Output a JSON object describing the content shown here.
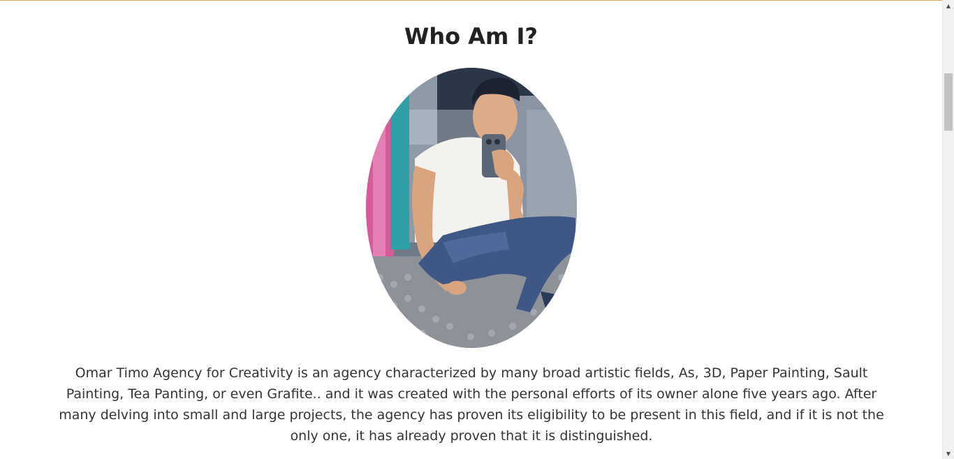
{
  "about": {
    "title": "Who Am I?",
    "photo_alt": "portrait-photo",
    "text": "Omar Timo Agency for Creativity is an agency characterized by many broad artistic fields, As, 3D, Paper Painting, Sault Painting, Tea Panting, or even Grafite.. and it was created with the personal efforts of its owner alone five years ago. After many delving into small and large projects, the agency has proven its eligibility to be present in this field, and if it is not the only one, it has already proven that it is distinguished."
  },
  "scrollbar": {
    "up_icon": "▲",
    "down_icon": "▼"
  },
  "colors": {
    "accent_border": "#e0a75a",
    "title": "#222222",
    "text": "#333333"
  }
}
